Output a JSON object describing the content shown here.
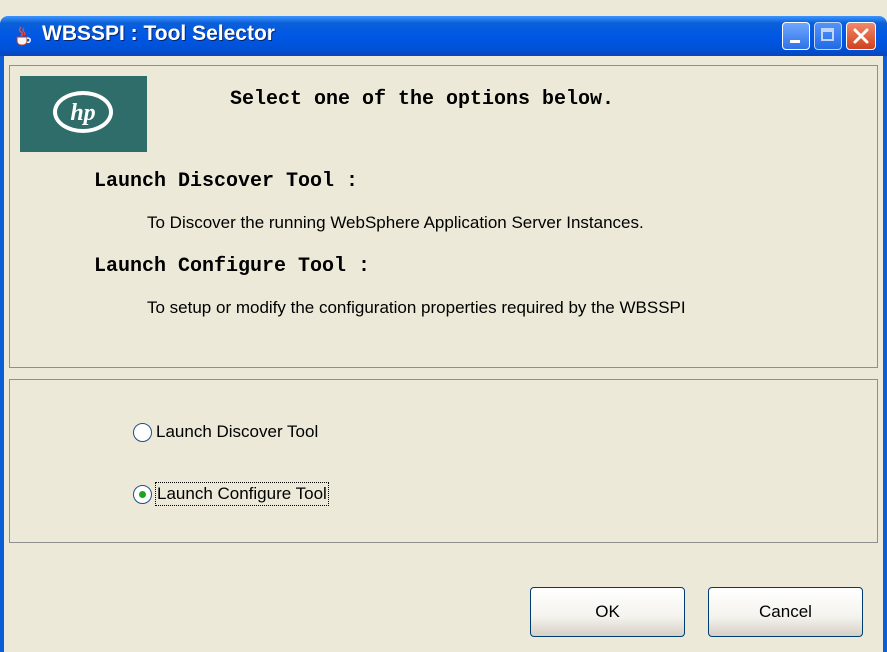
{
  "window": {
    "title": "WBSSPI : Tool Selector",
    "app_icon": "java-cup-icon"
  },
  "info": {
    "logo": "hp",
    "heading": "Select one of the options below.",
    "options": [
      {
        "title": "Launch Discover Tool :",
        "description": "To Discover the running WebSphere Application Server Instances."
      },
      {
        "title": "Launch Configure Tool :",
        "description": "To setup or modify the configuration properties required by the WBSSPI"
      }
    ]
  },
  "radios": [
    {
      "label": "Launch Discover Tool",
      "checked": false
    },
    {
      "label": "Launch Configure Tool",
      "checked": true
    }
  ],
  "buttons": {
    "ok_label": "OK",
    "cancel_label": "Cancel"
  },
  "colors": {
    "titlebar": "#0058e6",
    "logo_bg": "#2e6d6a",
    "window_bg": "#ece9d8"
  }
}
